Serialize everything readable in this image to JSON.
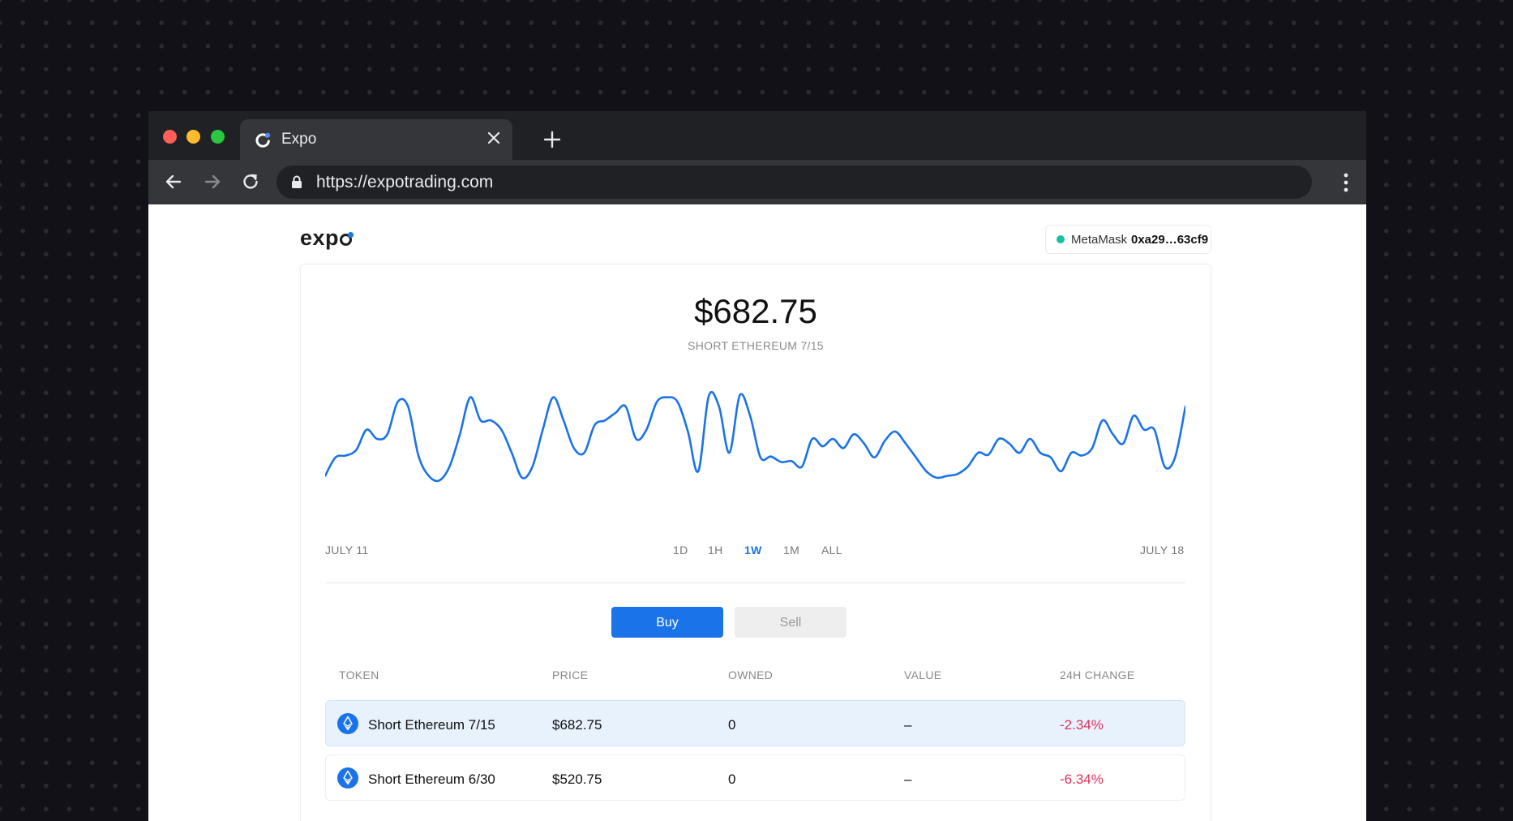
{
  "browser": {
    "tab_title": "Expo",
    "url": "https://expotrading.com"
  },
  "app": {
    "logo_text": "exp",
    "wallet": {
      "label": "MetaMask",
      "address": "0xa29…63cf9",
      "status_color": "#18c0a0"
    }
  },
  "summary": {
    "price": "$682.75",
    "token_name": "SHORT ETHEREUM 7/15"
  },
  "chart_data": {
    "type": "line",
    "x_start_label": "JULY 11",
    "x_end_label": "JULY 18",
    "color": "#1a73e8",
    "values": [
      0.1,
      0.3,
      0.32,
      0.38,
      0.6,
      0.5,
      0.55,
      0.9,
      0.85,
      0.32,
      0.1,
      0.05,
      0.2,
      0.55,
      0.95,
      0.7,
      0.7,
      0.6,
      0.35,
      0.08,
      0.2,
      0.6,
      0.95,
      0.7,
      0.4,
      0.35,
      0.65,
      0.7,
      0.78,
      0.85,
      0.5,
      0.6,
      0.9,
      0.95,
      0.9,
      0.58,
      0.15,
      0.96,
      0.85,
      0.35,
      0.97,
      0.75,
      0.3,
      0.31,
      0.25,
      0.26,
      0.2,
      0.5,
      0.42,
      0.5,
      0.4,
      0.55,
      0.45,
      0.3,
      0.48,
      0.58,
      0.45,
      0.3,
      0.15,
      0.08,
      0.1,
      0.12,
      0.2,
      0.35,
      0.33,
      0.5,
      0.45,
      0.35,
      0.5,
      0.35,
      0.3,
      0.15,
      0.35,
      0.32,
      0.4,
      0.7,
      0.55,
      0.45,
      0.75,
      0.6,
      0.6,
      0.2,
      0.3,
      0.85
    ],
    "ranges": [
      "1D",
      "1H",
      "1W",
      "1M",
      "ALL"
    ],
    "active_range": "1W"
  },
  "actions": {
    "buy_label": "Buy",
    "sell_label": "Sell"
  },
  "table": {
    "headers": [
      "TOKEN",
      "PRICE",
      "OWNED",
      "VALUE",
      "24H CHANGE"
    ],
    "rows": [
      {
        "token": "Short Ethereum 7/15",
        "price": "$682.75",
        "owned": "0",
        "value": "–",
        "change": "-2.34%",
        "selected": true
      },
      {
        "token": "Short Ethereum 6/30",
        "price": "$520.75",
        "owned": "0",
        "value": "–",
        "change": "-6.34%",
        "selected": false
      }
    ]
  }
}
